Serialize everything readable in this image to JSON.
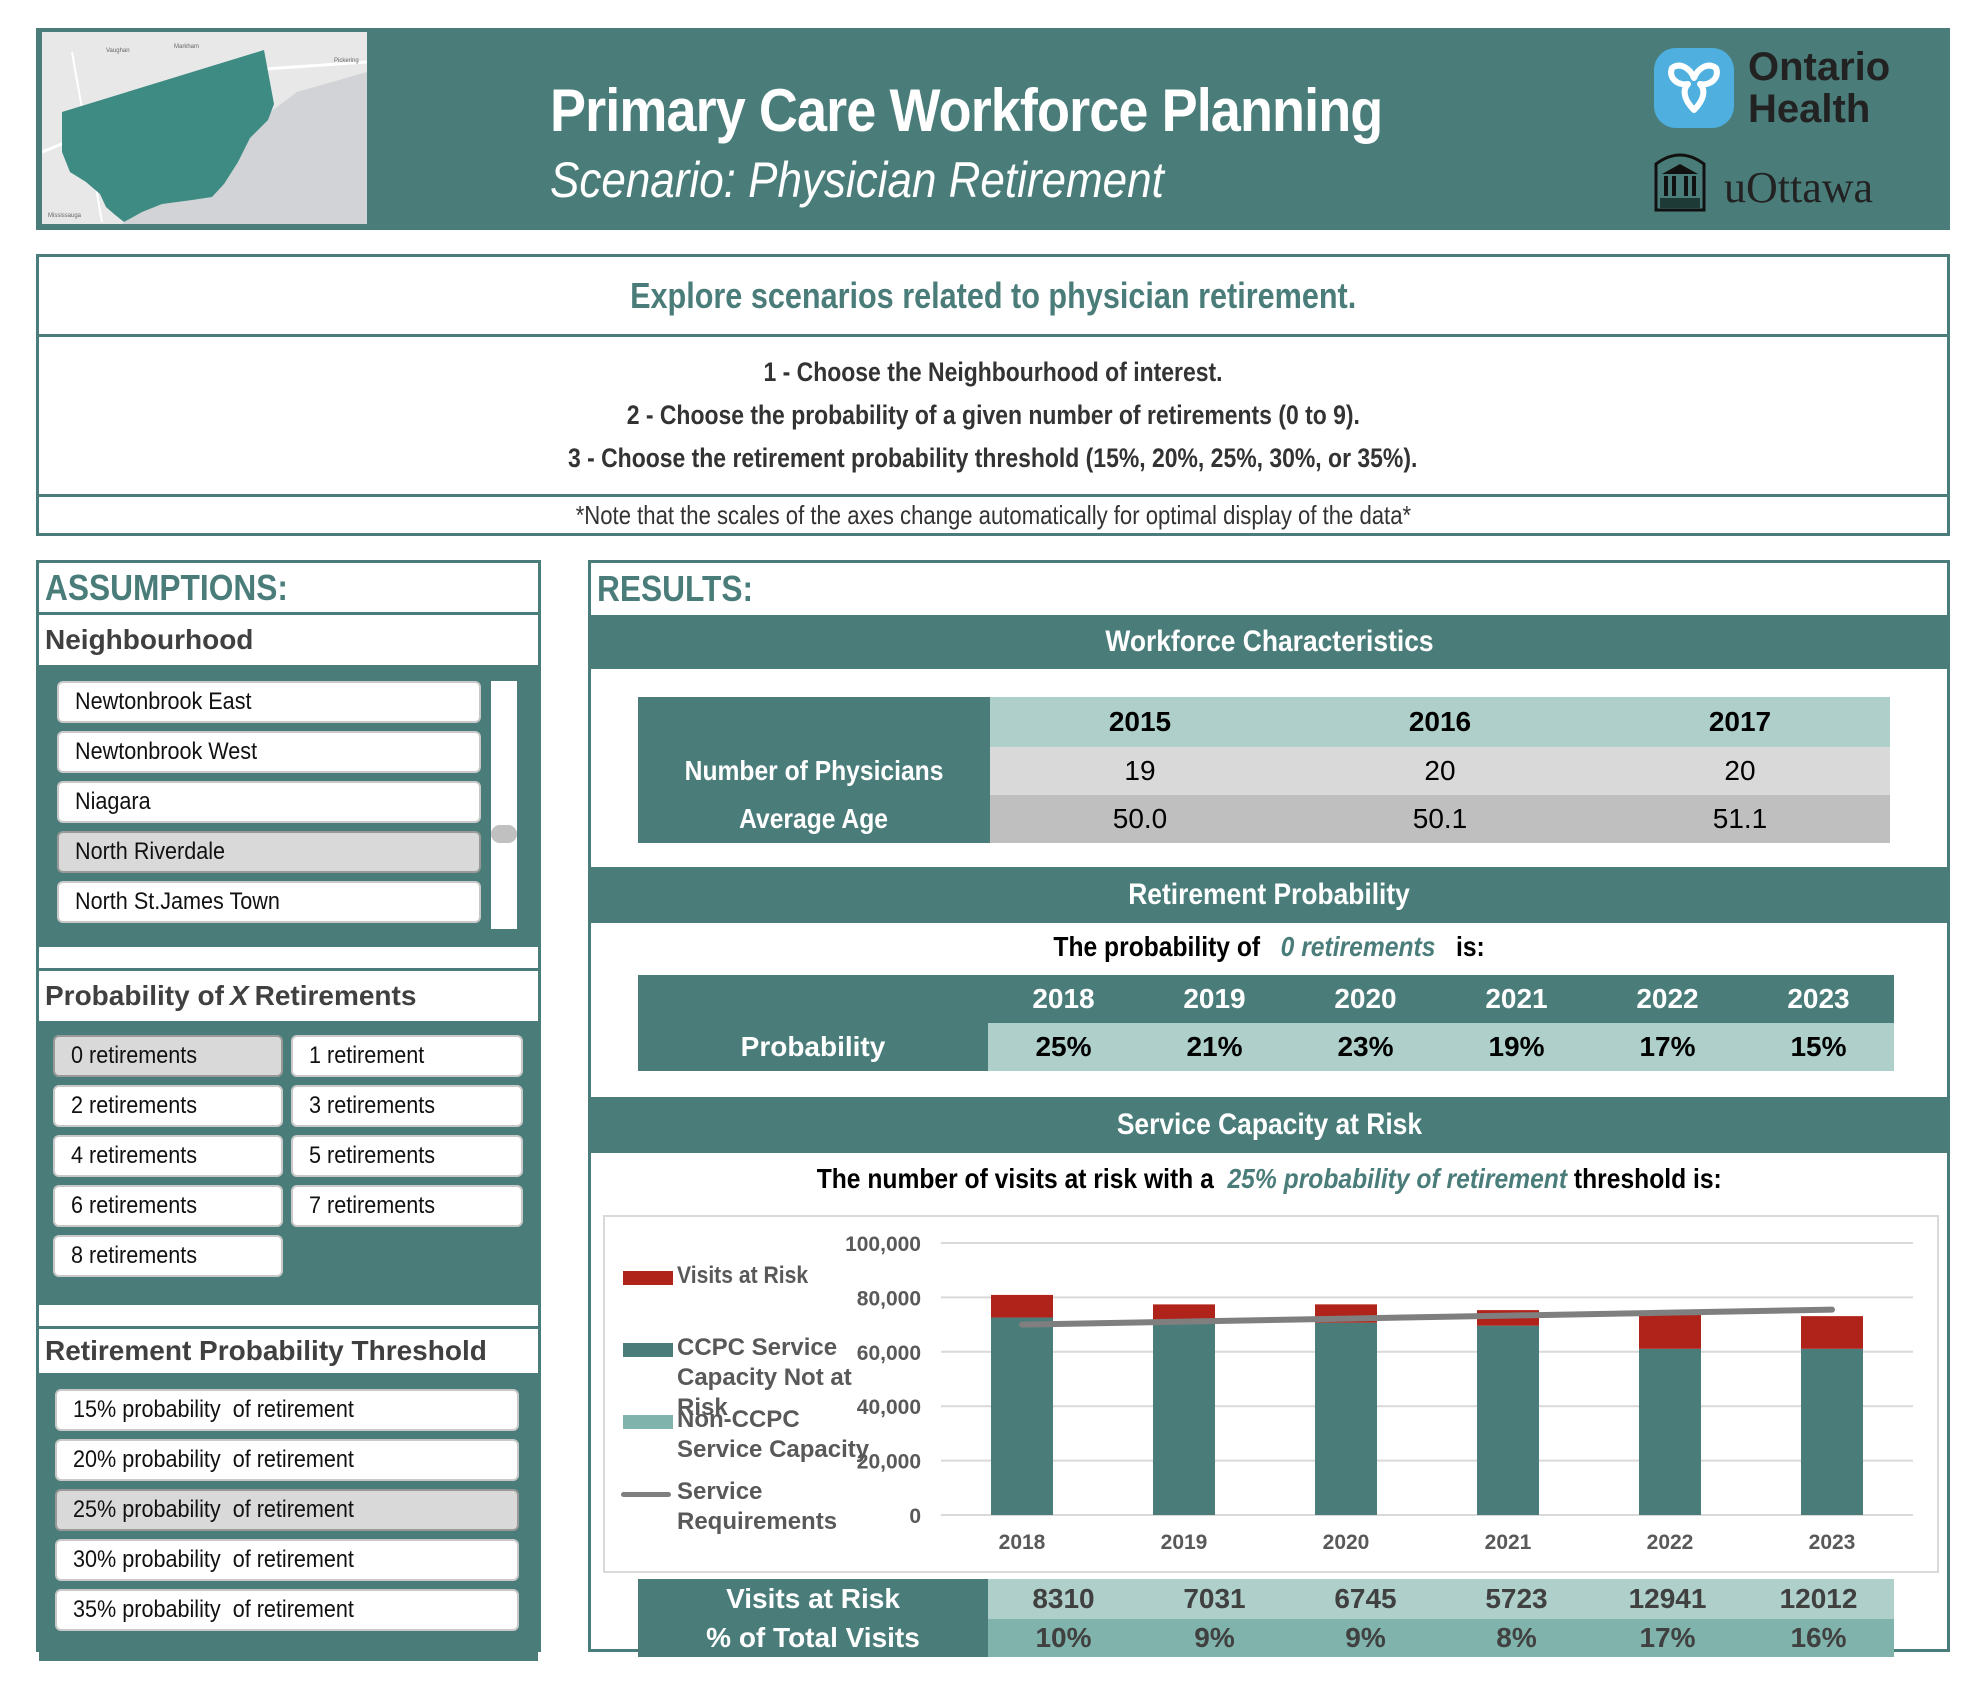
{
  "header": {
    "title": "Primary Care Workforce Planning",
    "subtitle": "Scenario: Physician Retirement",
    "logos": {
      "ontario_health_line1": "Ontario",
      "ontario_health_line2": "Health",
      "uottawa": "uOttawa"
    },
    "map_labels": [
      "Vaughan",
      "Markham",
      "Pickering",
      "Mississauga"
    ]
  },
  "intro": {
    "heading": "Explore scenarios related to physician retirement.",
    "steps": [
      "1 - Choose the Neighbourhood of interest.",
      "2 - Choose the probability of a given number of retirements (0 to 9).",
      "3 - Choose the retirement probability threshold (15%, 20%, 25%, 30%, or 35%)."
    ],
    "note": "*Note that the scales of the axes change automatically for optimal display of the data*"
  },
  "assumptions": {
    "title": "ASSUMPTIONS:",
    "neighbourhood": {
      "label": "Neighbourhood",
      "items": [
        "Newtonbrook East",
        "Newtonbrook West",
        "Niagara",
        "North Riverdale",
        "North St.James Town"
      ],
      "selected": "North Riverdale"
    },
    "retirements": {
      "label_pre": "Probability of ",
      "label_var": "X",
      "label_post": " Retirements",
      "items": [
        "0 retirements",
        "1 retirement",
        "2 retirements",
        "3 retirements",
        "4 retirements",
        "5 retirements",
        "6 retirements",
        "7 retirements",
        "8 retirements"
      ],
      "selected": "0 retirements"
    },
    "threshold": {
      "label": "Retirement Probability Threshold",
      "items": [
        "15% probability  of retirement",
        "20% probability  of retirement",
        "25% probability  of retirement",
        "30% probability  of retirement",
        "35% probability  of retirement"
      ],
      "selected": "25% probability  of retirement"
    }
  },
  "results": {
    "title": "RESULTS:",
    "workforce": {
      "band": "Workforce Characteristics",
      "years": [
        "2015",
        "2016",
        "2017"
      ],
      "rows": [
        {
          "label": "Number of Physicians",
          "values": [
            "19",
            "20",
            "20"
          ]
        },
        {
          "label": "Average Age",
          "values": [
            "50.0",
            "50.1",
            "51.1"
          ]
        }
      ]
    },
    "retirement_probability": {
      "band": "Retirement Probability",
      "sentence_pre": "The probability of",
      "sentence_var": "0 retirements",
      "sentence_post": "is:",
      "years": [
        "2018",
        "2019",
        "2020",
        "2021",
        "2022",
        "2023"
      ],
      "row_label": "Probability",
      "values": [
        "25%",
        "21%",
        "23%",
        "19%",
        "17%",
        "15%"
      ]
    },
    "service": {
      "band": "Service Capacity at Risk",
      "sentence_pre": "The number of visits at risk with a",
      "sentence_var": "25% probability of retirement",
      "sentence_post": "threshold is:",
      "summary_rows": [
        {
          "label": "Visits at Risk",
          "values": [
            "8310",
            "7031",
            "6745",
            "5723",
            "12941",
            "12012"
          ]
        },
        {
          "label": "% of Total Visits",
          "values": [
            "10%",
            "9%",
            "9%",
            "8%",
            "17%",
            "16%"
          ]
        }
      ]
    }
  },
  "colors": {
    "teal": "#4a7d7a",
    "light_teal": "#aecfca",
    "mid_teal": "#7fb3ab",
    "risk_red": "#b0231a",
    "line_gray": "#7f7f7f"
  },
  "chart_data": {
    "type": "bar",
    "stacked": true,
    "title": "",
    "xlabel": "",
    "ylabel": "",
    "categories": [
      "2018",
      "2019",
      "2020",
      "2021",
      "2022",
      "2023"
    ],
    "ylim": [
      0,
      100000
    ],
    "yticks": [
      "0",
      "20,000",
      "40,000",
      "60,000",
      "80,000",
      "100,000"
    ],
    "grid": true,
    "legend_position": "left",
    "series": [
      {
        "name": "CCPC Service Capacity Not at Risk",
        "type": "bar",
        "color": "#4a7d7a",
        "values": [
          72600,
          70400,
          70700,
          69600,
          61100,
          61100
        ]
      },
      {
        "name": "Visits at Risk",
        "type": "bar",
        "color": "#b0231a",
        "values": [
          8310,
          7031,
          6745,
          5723,
          12941,
          12012
        ]
      },
      {
        "name": "Non-CCPC Service Capacity",
        "type": "bar",
        "color": "#7fb3ab",
        "values": [
          0,
          0,
          0,
          0,
          0,
          0
        ]
      },
      {
        "name": "Service Requirements",
        "type": "line",
        "color": "#7f7f7f",
        "values": [
          70000,
          71100,
          72200,
          73300,
          74400,
          75500
        ]
      }
    ],
    "legend": [
      {
        "label": "Visits at Risk",
        "kind": "box",
        "color": "#b0231a"
      },
      {
        "label": "CCPC Service Capacity Not at Risk",
        "kind": "box",
        "color": "#4a7d7a"
      },
      {
        "label": "Non-CCPC Service Capacity",
        "kind": "box",
        "color": "#7fb3ab"
      },
      {
        "label": "Service Requirements",
        "kind": "line",
        "color": "#7f7f7f"
      }
    ]
  }
}
